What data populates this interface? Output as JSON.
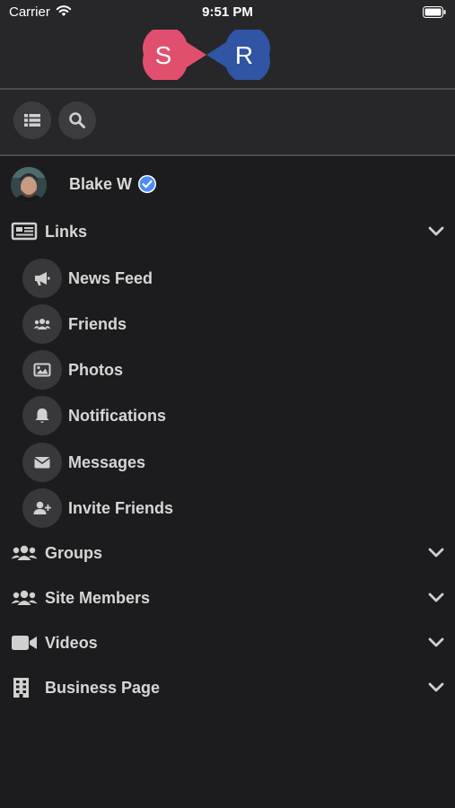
{
  "status_bar": {
    "carrier": "Carrier",
    "time": "9:51 PM"
  },
  "logo": {
    "left_letter": "S",
    "right_letter": "R",
    "left_color": "#e0506e",
    "right_color": "#2f55a4"
  },
  "toolbar": {
    "menu_icon": "list-icon",
    "search_icon": "search-icon"
  },
  "profile": {
    "name": "Blake W",
    "verified_color": "#4a8df5"
  },
  "sections": {
    "links": {
      "label": "Links",
      "icon": "newspaper-icon"
    },
    "groups": {
      "label": "Groups",
      "icon": "users-icon"
    },
    "site_members": {
      "label": "Site Members",
      "icon": "users-icon"
    },
    "videos": {
      "label": "Videos",
      "icon": "video-camera-icon"
    },
    "business_page": {
      "label": "Business Page",
      "icon": "building-icon"
    }
  },
  "links": [
    {
      "label": "News Feed",
      "icon": "megaphone-icon"
    },
    {
      "label": "Friends",
      "icon": "friends-icon"
    },
    {
      "label": "Photos",
      "icon": "image-icon"
    },
    {
      "label": "Notifications",
      "icon": "bell-icon"
    },
    {
      "label": "Messages",
      "icon": "envelope-icon"
    },
    {
      "label": "Invite Friends",
      "icon": "user-plus-icon"
    }
  ],
  "colors": {
    "background": "#1c1c1e",
    "header": "#27272a",
    "text": "#d6d6d6"
  }
}
